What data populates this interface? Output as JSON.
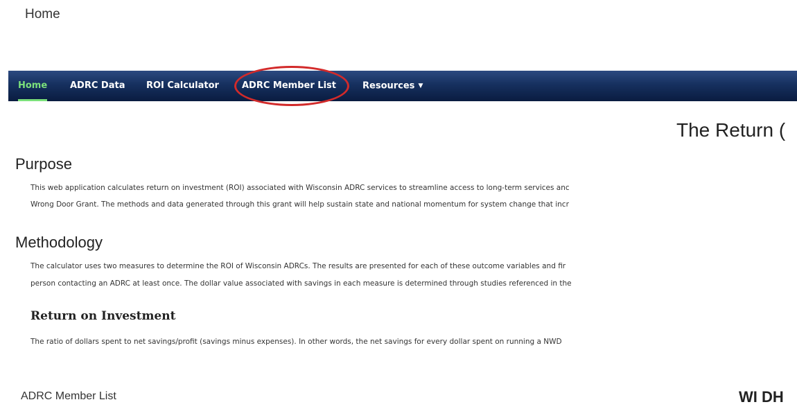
{
  "page": {
    "top_label": "Home",
    "bottom_label": "ADRC Member List",
    "bottom_right_heading": "WI DH"
  },
  "navbar": {
    "items": [
      {
        "label": "Home",
        "active": true
      },
      {
        "label": "ADRC Data",
        "active": false
      },
      {
        "label": "ROI Calculator",
        "active": false
      },
      {
        "label": "ADRC Member List",
        "active": false,
        "highlighted": true
      },
      {
        "label": "Resources",
        "active": false,
        "has_dropdown": true
      }
    ],
    "active_color": "#7be07b",
    "highlight_color": "#d22a2a"
  },
  "main": {
    "heading": "The Return (",
    "purpose": {
      "title": "Purpose",
      "lines": [
        "This web application calculates return on investment (ROI) associated with Wisconsin ADRC services to streamline access to long-term services anc",
        "Wrong Door Grant. The methods and data generated through this grant will help sustain state and national momentum for system change that incr"
      ]
    },
    "methodology": {
      "title": "Methodology",
      "lines": [
        "The calculator uses two measures to determine the ROI of Wisconsin ADRCs. The results are presented for each of these outcome variables and fir",
        "person contacting an ADRC at least once. The dollar value associated with savings in each measure is determined through studies referenced in the"
      ]
    },
    "roi": {
      "title": "Return on Investment",
      "line": "The ratio of dollars spent to net savings/profit (savings minus expenses). In other words, the net savings for every dollar spent on running a NWD"
    }
  }
}
